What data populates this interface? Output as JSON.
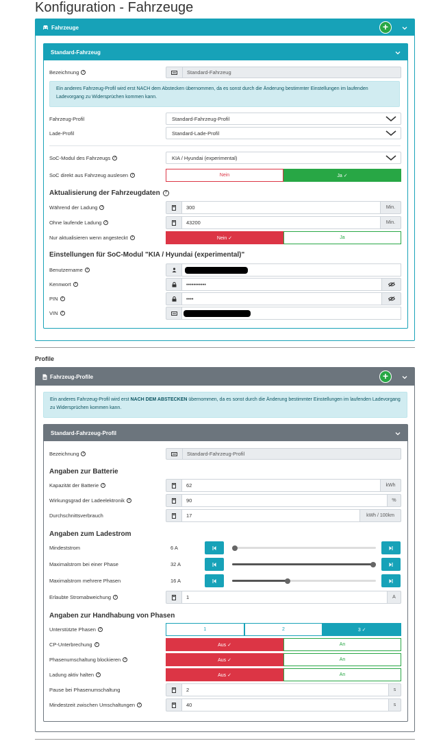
{
  "page": {
    "title": "Konfiguration - Fahrzeuge",
    "profile_heading": "Profile"
  },
  "vehicles_card": {
    "title": "Fahrzeuge",
    "add_icon": "plus-circle-icon",
    "collapse_icon": "chevron-down-icon",
    "icon": "car-icon"
  },
  "vehicle": {
    "title": "Standard-Fahrzeug",
    "name_label": "Bezeichnung",
    "name_value": "Standard-Fahrzeug",
    "info": "Ein anderes Fahrzeug-Profil wird erst NACH dem Abstecken übernommen, da es sonst durch die Änderung bestimmter Einstellungen im laufenden Ladevorgang zu Widersprüchen kommen kann.",
    "vehicle_profile_label": "Fahrzeug-Profil",
    "vehicle_profile_value": "Standard-Fahrzeug-Profil",
    "charge_profile_label": "Lade-Profil",
    "charge_profile_value": "Standard-Lade-Profil",
    "soc_module_label": "SoC-Modul des Fahrzeugs",
    "soc_module_value": "KIA / Hyundai (experimental)",
    "soc_direct_label": "SoC direkt aus Fahrzeug auslesen",
    "soc_direct_no": "Nein",
    "soc_direct_yes": "Ja ✓",
    "update_heading": "Aktualisierung der Fahrzeugdaten",
    "during_charge_label": "Während der Ladung",
    "during_charge_value": "300",
    "during_charge_unit": "Min.",
    "no_charge_label": "Ohne laufende Ladung",
    "no_charge_value": "43200",
    "no_charge_unit": "Min.",
    "only_plugged_label": "Nur aktualisieren wenn angesteckt",
    "only_plugged_no": "Nein ✓",
    "only_plugged_yes": "Ja",
    "soc_settings_heading": "Einstellungen für SoC-Modul \"KIA / Hyundai (experimental)\"",
    "username_label": "Benutzername",
    "password_label": "Kennwort",
    "password_value": "•••••••••••",
    "pin_label": "PIN",
    "pin_value": "••••",
    "vin_label": "VIN"
  },
  "profiles_card": {
    "title": "Fahrzeug-Profile",
    "info_prefix": "Ein anderes Fahrzeug-Profil wird erst ",
    "info_bold": "NACH DEM ABSTECKEN",
    "info_suffix": " übernommen, da es sonst durch die Änderung bestimmter Einstellungen im laufenden Ladevorgang zu Widersprüchen kommen kann."
  },
  "profile": {
    "title": "Standard-Fahrzeug-Profil",
    "name_label": "Bezeichnung",
    "name_value": "Standard-Fahrzeug-Profil",
    "battery_heading": "Angaben zur Batterie",
    "capacity_label": "Kapazität der Batterie",
    "capacity_value": "62",
    "capacity_unit": "kWh",
    "efficiency_label": "Wirkungsgrad der Ladeelektronik",
    "efficiency_value": "90",
    "efficiency_unit": "%",
    "consumption_label": "Durchschnittsverbrauch",
    "consumption_value": "17",
    "consumption_unit": "kWh / 100km",
    "current_heading": "Angaben zum Ladestrom",
    "min_current_label": "Mindeststrom",
    "min_current_value": "6 A",
    "min_current_level": 0.0,
    "max_one_label": "Maximalstrom bei einer Phase",
    "max_one_value": "32 A",
    "max_one_level": 1.0,
    "max_multi_label": "Maximalstrom mehrere Phasen",
    "max_multi_value": "16 A",
    "max_multi_level": 0.38,
    "deviation_label": "Erlaubte Stromabweichung",
    "deviation_value": "1",
    "deviation_unit": "A",
    "phases_heading": "Angaben zur Handhabung von Phasen",
    "supported_phases_label": "Unterstützte Phasen",
    "phase_1": "1",
    "phase_2": "2",
    "phase_3": "3 ✓",
    "cp_label": "CP-Unterbrechung",
    "block_label": "Phasenumschaltung blockieren",
    "keep_label": "Ladung aktiv halten",
    "off_selected": "Aus ✓",
    "on": "An",
    "pause_label": "Pause bei Phasenumschaltung",
    "pause_value": "2",
    "pause_unit": "s",
    "min_time_label": "Mindestzeit zwischen Umschaltungen",
    "min_time_value": "40",
    "min_time_unit": "s"
  },
  "colors": {
    "info": "#17a2b8",
    "success": "#28a745",
    "danger": "#dc3545",
    "secondary": "#6c757d"
  }
}
